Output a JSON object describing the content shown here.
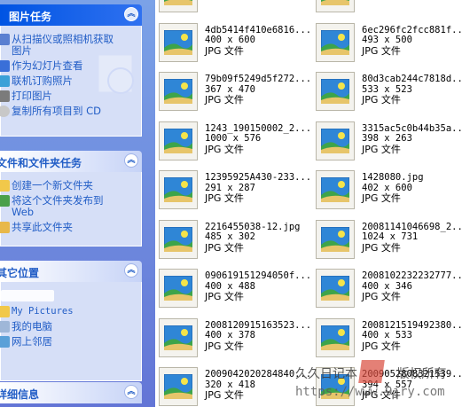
{
  "taskpane": {
    "picture_tasks": {
      "title": "图片任务",
      "items": [
        {
          "label": "从扫描仪或照相机获取\n图片",
          "icon": "camera-icon"
        },
        {
          "label": "作为幻灯片查看",
          "icon": "slideshow-icon"
        },
        {
          "label": "联机订购照片",
          "icon": "order-prints-icon"
        },
        {
          "label": "打印图片",
          "icon": "printer-icon"
        },
        {
          "label": "复制所有项目到 CD",
          "icon": "cd-icon"
        }
      ]
    },
    "file_tasks": {
      "title": "文件和文件夹任务",
      "items": [
        {
          "label": "创建一个新文件夹",
          "icon": "new-folder-icon"
        },
        {
          "label": "将这个文件夹发布到\nWeb",
          "icon": "publish-web-icon"
        },
        {
          "label": "共享此文件夹",
          "icon": "share-folder-icon"
        }
      ]
    },
    "other_places": {
      "title": "其它位置",
      "items": [
        {
          "label": "",
          "icon": "blurred-place-icon"
        },
        {
          "label": "My Pictures",
          "icon": "my-pictures-icon"
        },
        {
          "label": "我的电脑",
          "icon": "my-computer-icon"
        },
        {
          "label": "网上邻居",
          "icon": "network-icon"
        }
      ]
    },
    "details": {
      "title": "详细信息"
    }
  },
  "files": [
    {
      "name": "",
      "dims": "",
      "type": "JPG 文件"
    },
    {
      "name": "",
      "dims": "",
      "type": "JPG 文件"
    },
    {
      "name": "4db5414f410e6816...",
      "dims": "400 x 600",
      "type": "JPG 文件"
    },
    {
      "name": "6ec296fc2fcc881f...",
      "dims": "493 x 500",
      "type": "JPG 文件"
    },
    {
      "name": "79b09f5249d5f272...",
      "dims": "367 x 470",
      "type": "JPG 文件"
    },
    {
      "name": "80d3cab244c7818d...",
      "dims": "533 x 523",
      "type": "JPG 文件"
    },
    {
      "name": "1243_190150002_2...",
      "dims": "1000 x 576",
      "type": "JPG 文件"
    },
    {
      "name": "3315ac5c0b44b35a...",
      "dims": "398 x 263",
      "type": "JPG 文件"
    },
    {
      "name": "12395925A430-233...",
      "dims": "291 x 287",
      "type": "JPG 文件"
    },
    {
      "name": "1428080.jpg",
      "dims": "402 x 600",
      "type": "JPG 文件"
    },
    {
      "name": "2216455038-12.jpg",
      "dims": "485 x 302",
      "type": "JPG 文件"
    },
    {
      "name": "20081141046698_2...",
      "dims": "1024 x 731",
      "type": "JPG 文件"
    },
    {
      "name": "090619151294050f...",
      "dims": "400 x 488",
      "type": "JPG 文件"
    },
    {
      "name": "2008102232232777...",
      "dims": "400 x 346",
      "type": "JPG 文件"
    },
    {
      "name": "2008120915163523...",
      "dims": "400 x 378",
      "type": "JPG 文件"
    },
    {
      "name": "2008121519492380...",
      "dims": "400 x 533",
      "type": "JPG 文件"
    },
    {
      "name": "2009042020284840...",
      "dims": "320 x 418",
      "type": "JPG 文件"
    },
    {
      "name": "2009052808321539...",
      "dims": "394 x 557",
      "type": "JPG 文件"
    }
  ],
  "watermark": {
    "line1": "久久日记本",
    "line1b": "版权所有",
    "line2": "https://www.9jry.com"
  },
  "colors": {
    "pane_gradient_top": "#7ba2e7",
    "pane_gradient_bottom": "#6375d6",
    "panel_body": "#d6dff7",
    "link_blue": "#215dc6",
    "header_blue": "#0054e3"
  }
}
